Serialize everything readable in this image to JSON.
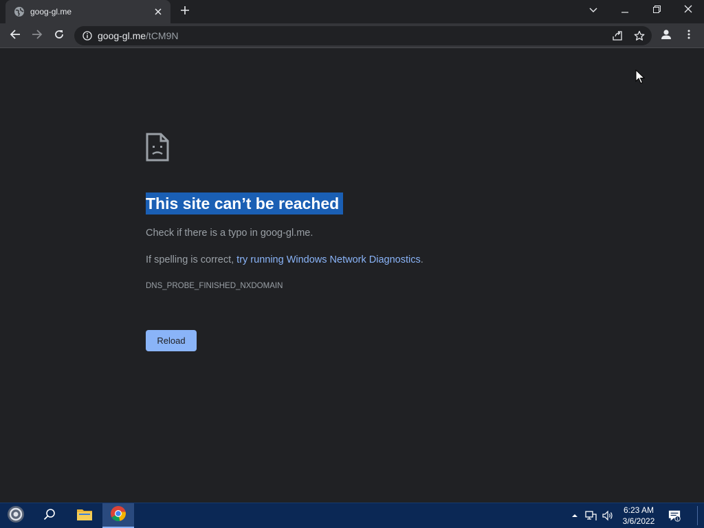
{
  "browser": {
    "tab": {
      "title": "goog-gl.me"
    },
    "address_bar": {
      "domain": "goog-gl.me",
      "path": "/tCM9N"
    }
  },
  "error_page": {
    "heading": "This site can’t be reached",
    "hint_typo": "Check if there is a typo in goog-gl.me.",
    "hint_spelling_prefix": "If spelling is correct, ",
    "hint_spelling_link": "try running Windows Network Diagnostics",
    "hint_spelling_suffix": ".",
    "error_code": "DNS_PROBE_FINISHED_NXDOMAIN",
    "reload_label": "Reload"
  },
  "taskbar": {
    "time": "6:23 AM",
    "date": "3/6/2022",
    "notification_count": "1"
  },
  "icons": {
    "tab_favicon": "globe-icon",
    "tab_close": "close-icon",
    "new_tab": "plus-icon",
    "tab_search": "chevron-down-icon",
    "minimize": "minimize-icon",
    "restore": "restore-icon",
    "close_window": "close-icon",
    "back": "back-arrow-icon",
    "forward": "forward-arrow-icon",
    "reload": "reload-icon",
    "site_info": "info-icon",
    "share": "share-icon",
    "bookmark": "star-icon",
    "profile": "profile-icon",
    "menu": "kebab-menu-icon",
    "error": "sad-page-icon"
  },
  "colors": {
    "page_background": "#202124",
    "selection_highlight": "#1a5fb4",
    "link": "#8ab4f8",
    "reload_button": "#8ab4f8",
    "taskbar": "#0b2855"
  }
}
